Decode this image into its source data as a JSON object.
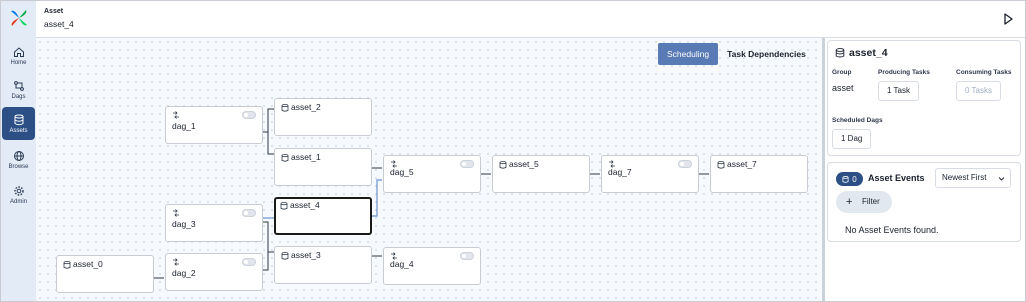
{
  "nav": [
    {
      "label": "Home",
      "icon": "home-icon"
    },
    {
      "label": "Dags",
      "icon": "dags-icon"
    },
    {
      "label": "Assets",
      "icon": "database-icon"
    },
    {
      "label": "Browse",
      "icon": "globe-icon"
    },
    {
      "label": "Admin",
      "icon": "gear-icon"
    }
  ],
  "header": {
    "section": "Asset",
    "name": "asset_4"
  },
  "toggle": {
    "scheduling": "Scheduling",
    "task_dependencies": "Task Dependencies"
  },
  "graph": {
    "nodes": {
      "asset_0": "asset_0",
      "asset_1": "asset_1",
      "asset_2": "asset_2",
      "asset_3": "asset_3",
      "asset_4": "asset_4",
      "asset_5": "asset_5",
      "asset_7": "asset_7",
      "dag_1": "dag_1",
      "dag_2": "dag_2",
      "dag_3": "dag_3",
      "dag_4": "dag_4",
      "dag_5": "dag_5",
      "dag_7": "dag_7"
    }
  },
  "details": {
    "title": "asset_4",
    "group_label": "Group",
    "group_value": "asset",
    "producing_label": "Producing Tasks",
    "producing_value": "1 Task",
    "consuming_label": "Consuming Tasks",
    "consuming_value": "0 Tasks",
    "scheduled_label": "Scheduled Dags",
    "scheduled_value": "1 Dag"
  },
  "events": {
    "count": "0",
    "title": "Asset Events",
    "sort": "Newest First",
    "filter": "Filter",
    "empty": "No Asset Events found."
  },
  "colors": {
    "accent": "#2c4f86",
    "selected_toggle": "#587ab5",
    "edge": "#7fa3d6"
  }
}
